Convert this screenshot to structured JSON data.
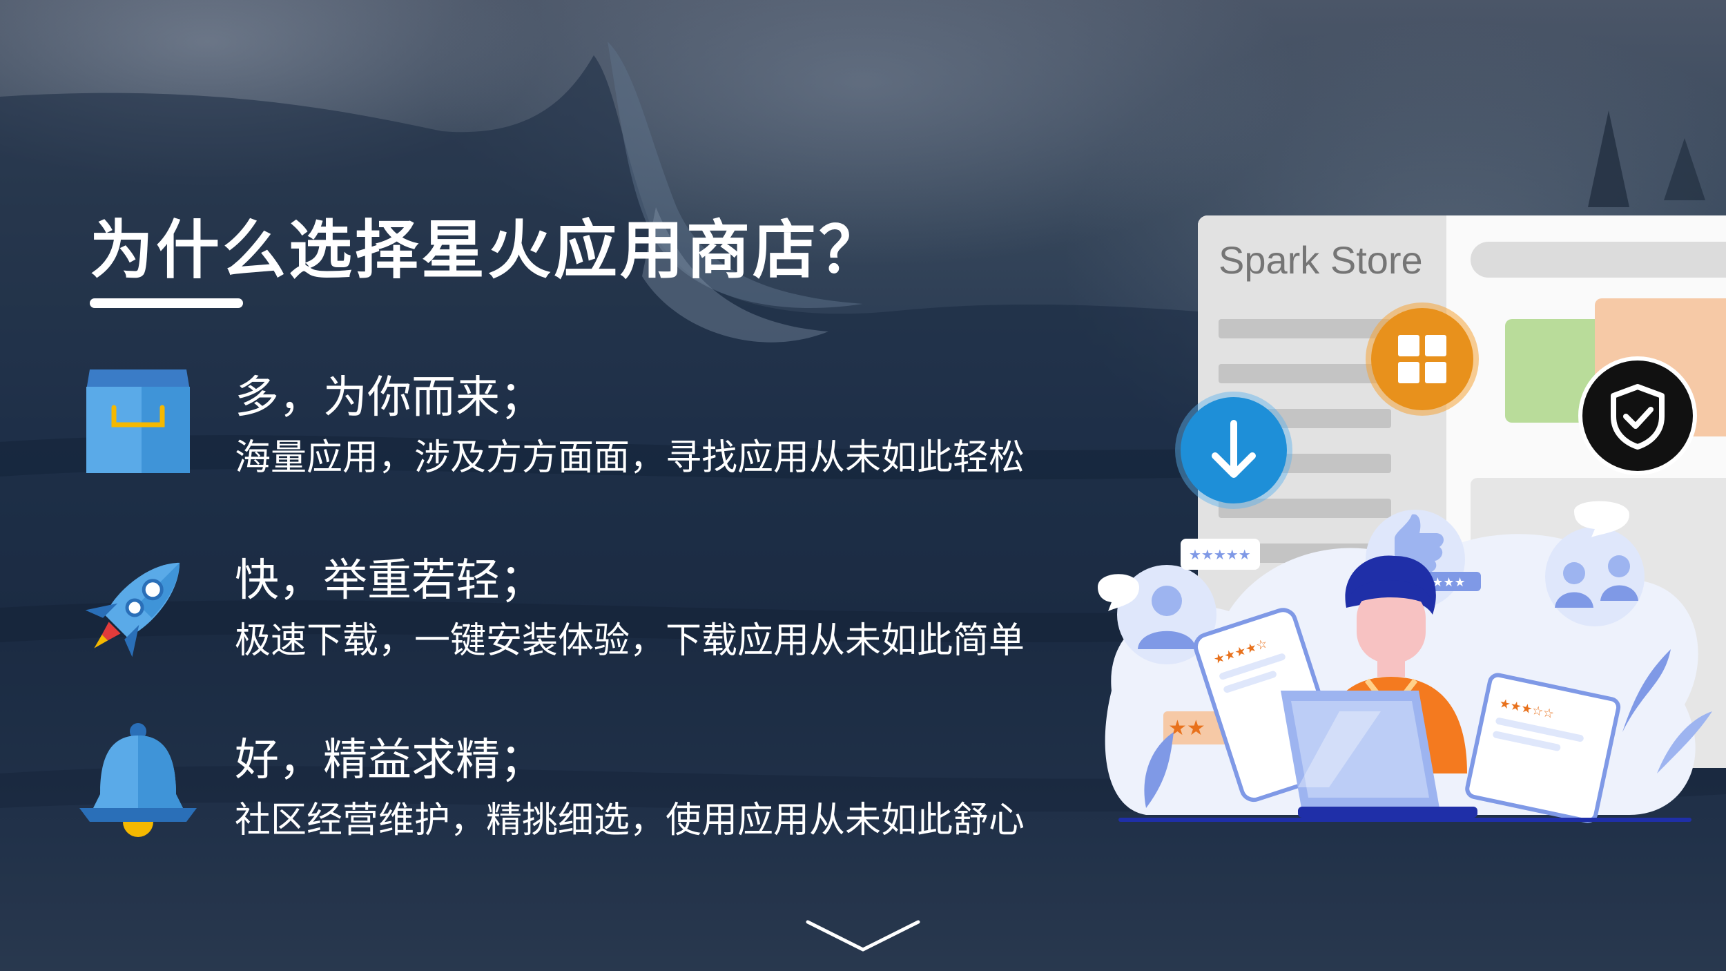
{
  "title": "为什么选择星火应用商店？",
  "features": [
    {
      "icon": "shopping-bag-icon",
      "heading": "多，为你而来；",
      "description": "海量应用，涉及方方面面，寻找应用从未如此轻松"
    },
    {
      "icon": "rocket-icon",
      "heading": "快，举重若轻；",
      "description": "极速下载，一键安装体验，下载应用从未如此简单"
    },
    {
      "icon": "bell-icon",
      "heading": "好，精益求精；",
      "description": "社区经营维护，精挑细选，使用应用从未如此舒心"
    }
  ],
  "illustration": {
    "window_brand": "Spark Store",
    "badges": [
      "app-grid-icon",
      "download-icon",
      "shield-check-icon"
    ]
  },
  "scroll_hint": "chevron-down-icon",
  "colors": {
    "accent_orange": "#e8911c",
    "accent_blue": "#1e8fd8",
    "badge_black": "#111111",
    "text": "#ffffff"
  }
}
